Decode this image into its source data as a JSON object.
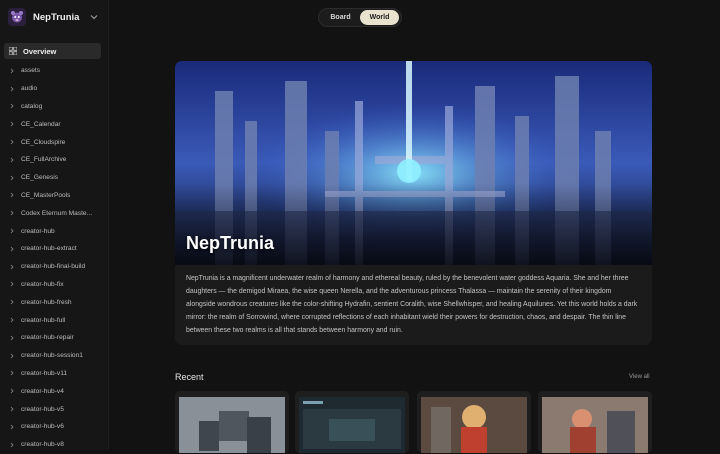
{
  "app": {
    "name": "NepTrunia"
  },
  "sidebar": {
    "overview_label": "Overview",
    "folders": [
      "assets",
      "audio",
      "catalog",
      "CE_Calendar",
      "CE_Cloudspire",
      "CE_FullArchive",
      "CE_Genesis",
      "CE_MasterPools",
      "Codex Eternum Maste...",
      "creator-hub",
      "creator-hub-extract",
      "creator-hub-final-build",
      "creator-hub-fix",
      "creator-hub-fresh",
      "creator-hub-full",
      "creator-hub-repair",
      "creator-hub-session1",
      "creator-hub-v11",
      "creator-hub-v4",
      "creator-hub-v5",
      "creator-hub-v6",
      "creator-hub-v8"
    ]
  },
  "view_toggle": {
    "options": [
      "Board",
      "World"
    ],
    "active": "World"
  },
  "hero": {
    "title": "NepTrunia",
    "description": "NepTrunia is a magnificent underwater realm of harmony and ethereal beauty, ruled by the benevolent water goddess Aquaria. She and her three daughters — the demigod Miraea, the wise queen Nerella, and the adventurous princess Thalassa — maintain the serenity of their kingdom alongside wondrous creatures like the color-shifting Hydrafin, sentient Coralith, wise Shellwhisper, and healing Aquilunes. Yet this world holds a dark mirror: the realm of Sorrowind, where corrupted reflections of each inhabitant wield their powers for destruction, chaos, and despair. The thin line between these two realms is all that stands between harmony and ruin."
  },
  "recent": {
    "title": "Recent",
    "view_all_label": "View all",
    "items": [
      {
        "icon": "mech-robot-thumbnail"
      },
      {
        "icon": "document-screenshot-thumbnail"
      },
      {
        "icon": "anime-warrior-thumbnail"
      },
      {
        "icon": "warrior-mech-thumbnail"
      }
    ]
  },
  "colors": {
    "background": "#121212",
    "sidebar": "#161616",
    "active_toggle": "#e8e2cf",
    "accent_blue": "#4aa8ff"
  }
}
